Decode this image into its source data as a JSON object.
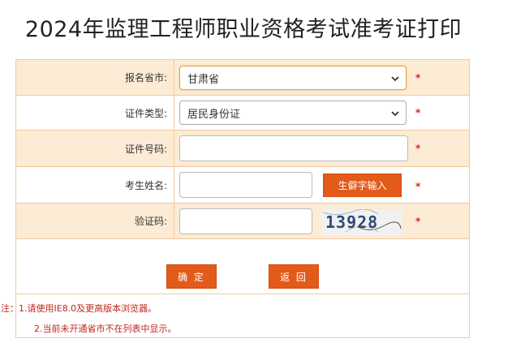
{
  "page": {
    "title": "2024年监理工程师职业资格考试准考证打印"
  },
  "form": {
    "province": {
      "label": "报名省市:",
      "selected": "甘肃省",
      "required_mark": "*"
    },
    "id_type": {
      "label": "证件类型:",
      "selected": "居民身份证",
      "required_mark": "*"
    },
    "id_number": {
      "label": "证件号码:",
      "value": "",
      "required_mark": "*"
    },
    "name": {
      "label": "考生姓名:",
      "value": "",
      "rare_char_button": "生僻字输入",
      "required_mark": "*"
    },
    "captcha": {
      "label": "验证码:",
      "value": "",
      "image_text": "13928",
      "required_mark": "*"
    }
  },
  "actions": {
    "confirm": "确 定",
    "back": "返 回"
  },
  "notes": {
    "line1": "注：1.请使用IE8.0及更高版本浏览器。",
    "line2": "2.当前未开通省市不在列表中显示。"
  },
  "colors": {
    "accent_orange": "#e35a1a",
    "row_shade": "#fcebd5",
    "border": "#f0c9a0",
    "required_red": "#d9251c"
  }
}
